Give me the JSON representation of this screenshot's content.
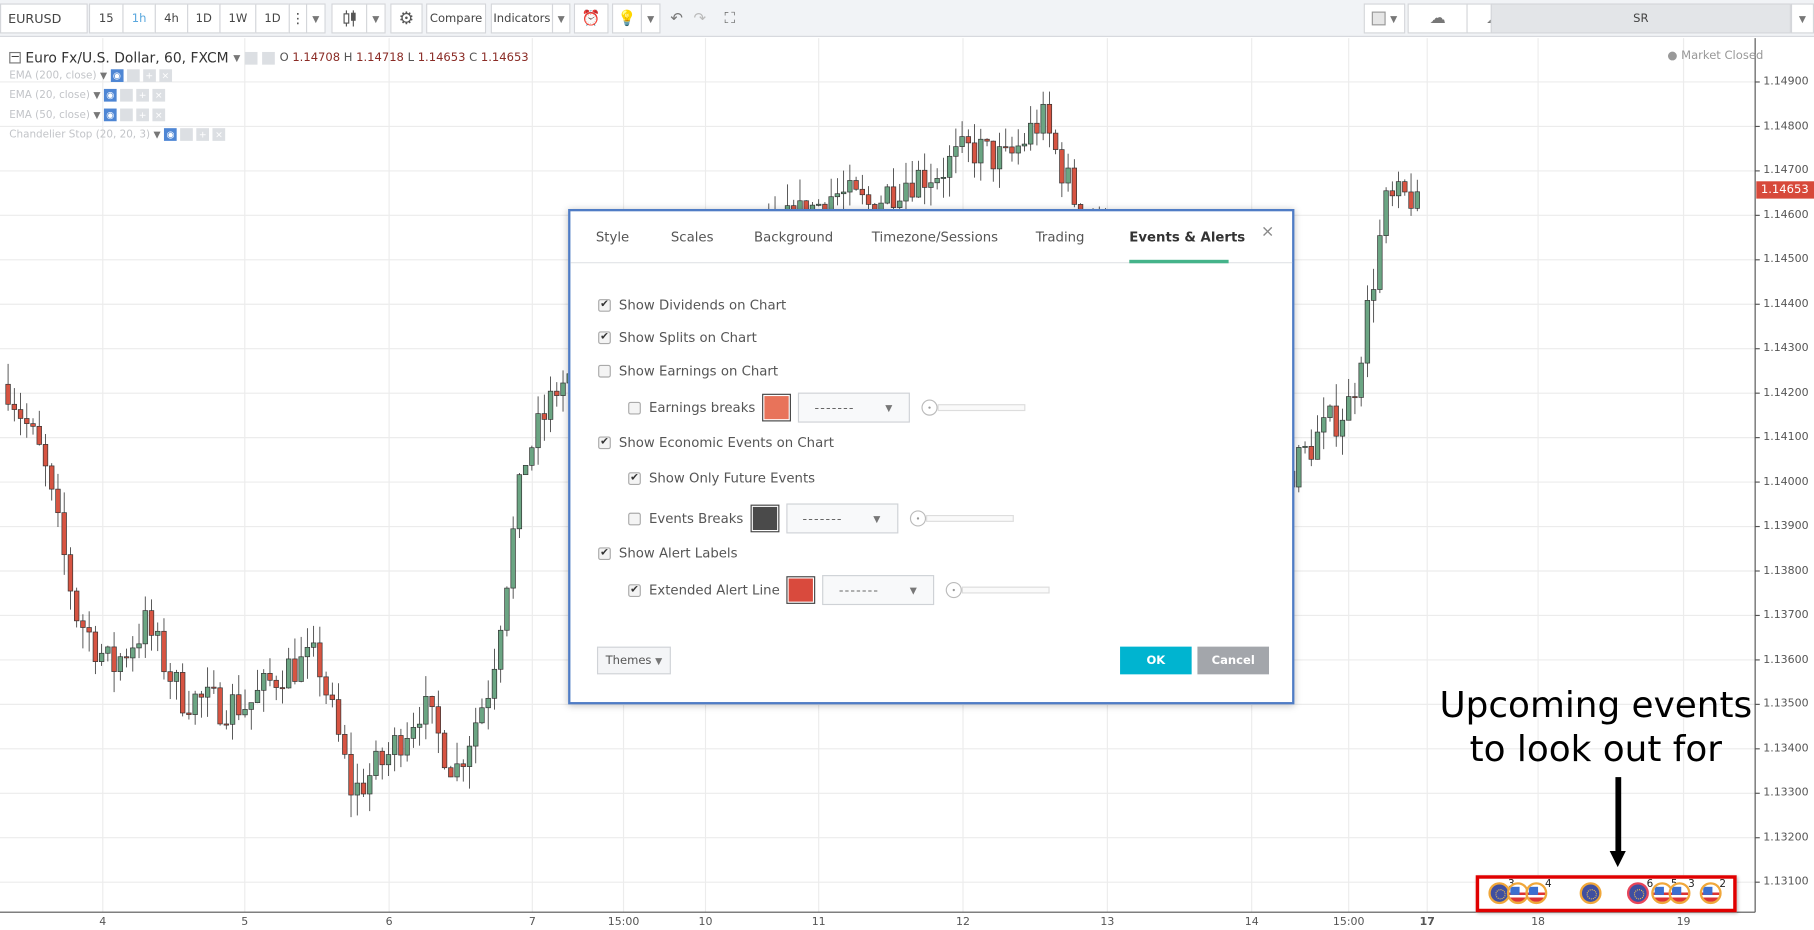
{
  "toolbar": {
    "symbol": "EURUSD",
    "intervals": [
      "15",
      "1h",
      "4h",
      "1D",
      "1W",
      "1D"
    ],
    "active_interval": "1h",
    "compare_label": "Compare",
    "indicators_label": "Indicators",
    "user_label": "SR",
    "icons": [
      "more-vertical-icon",
      "candlestick-icon",
      "gear-icon",
      "alert-add-icon",
      "lightbulb-icon",
      "undo-icon",
      "redo-icon",
      "fullscreen-icon",
      "layout-square-icon",
      "cloud-download-icon",
      "cloud-upload-icon"
    ]
  },
  "legend": {
    "title": "Euro Fx/U.S. Dollar, 60, FXCM",
    "o_label": "O",
    "o": "1.14708",
    "h_label": "H",
    "h": "1.14718",
    "l_label": "L",
    "l": "1.14653",
    "c_label": "C",
    "c": "1.14653"
  },
  "indicators": [
    "EMA (200, close)",
    "EMA (20, close)",
    "EMA (50, close)",
    "Chandelier Stop (20, 20, 3)"
  ],
  "market_status": "Market Closed",
  "price_axis": {
    "ticks": [
      "1.14900",
      "1.14800",
      "1.14700",
      "1.14600",
      "1.14500",
      "1.14400",
      "1.14300",
      "1.14200",
      "1.14100",
      "1.14000",
      "1.13900",
      "1.13800",
      "1.13700",
      "1.13600",
      "1.13500",
      "1.13400",
      "1.13300",
      "1.13200",
      "1.13100"
    ],
    "last_price": "1.14653",
    "last_price_color": "#d7493a"
  },
  "time_axis": {
    "labels": [
      "4",
      "5",
      "6",
      "7",
      "15:00",
      "10",
      "11",
      "12",
      "13",
      "14",
      "15:00",
      "17",
      "18",
      "19"
    ]
  },
  "chart_data": {
    "type": "candlestick",
    "up_color": "#6ba583",
    "down_color": "#d75442",
    "approx_close_path": [
      1.1422,
      1.1405,
      1.137,
      1.1358,
      1.1368,
      1.1352,
      1.135,
      1.135,
      1.1358,
      1.136,
      1.133,
      1.1338,
      1.135,
      1.1335,
      1.1355,
      1.1405,
      1.1422,
      1.1425,
      1.143,
      1.144,
      1.145,
      1.1445,
      1.1455,
      1.146,
      1.1465,
      1.1462,
      1.1468,
      1.147,
      1.1475,
      1.1472,
      1.1482,
      1.1463,
      1.1455,
      1.144,
      1.143,
      1.142,
      1.1405,
      1.14,
      1.141,
      1.1418,
      1.1462,
      1.14653
    ]
  },
  "dialog": {
    "tabs": [
      "Style",
      "Scales",
      "Background",
      "Timezone/Sessions",
      "Trading",
      "Events & Alerts"
    ],
    "active_tab": "Events & Alerts",
    "close_label": "×",
    "options": [
      {
        "label": "Show Dividends on Chart",
        "checked": true
      },
      {
        "label": "Show Splits on Chart",
        "checked": true
      },
      {
        "label": "Show Earnings on Chart",
        "checked": false
      },
      {
        "label": "Earnings breaks",
        "checked": false,
        "color": "#e8735a",
        "line_style": "-------"
      },
      {
        "label": "Show Economic Events on Chart",
        "checked": true
      },
      {
        "label": "Show Only Future Events",
        "checked": true
      },
      {
        "label": "Events Breaks",
        "checked": false,
        "color": "#4a4a4a",
        "line_style": "-------"
      },
      {
        "label": "Show Alert Labels",
        "checked": true
      },
      {
        "label": "Extended Alert Line",
        "checked": true,
        "color": "#d94a3d",
        "line_style": "-------"
      }
    ],
    "themes_label": "Themes",
    "ok_label": "OK",
    "cancel_label": "Cancel"
  },
  "annotation": {
    "line1": "Upcoming events",
    "line2": "to look out for"
  },
  "events": [
    {
      "icon": "globe-icon",
      "count": "3"
    },
    {
      "icon": "us-flag-icon",
      "count": ""
    },
    {
      "icon": "us-flag-icon",
      "count": "4"
    },
    {
      "icon": "globe-icon",
      "count": ""
    },
    {
      "icon": "globe-icon",
      "count": "6",
      "highlight": true
    },
    {
      "icon": "us-flag-icon",
      "count": "5"
    },
    {
      "icon": "us-flag-icon",
      "count": "3"
    },
    {
      "icon": "us-flag-icon",
      "count": "2"
    }
  ]
}
